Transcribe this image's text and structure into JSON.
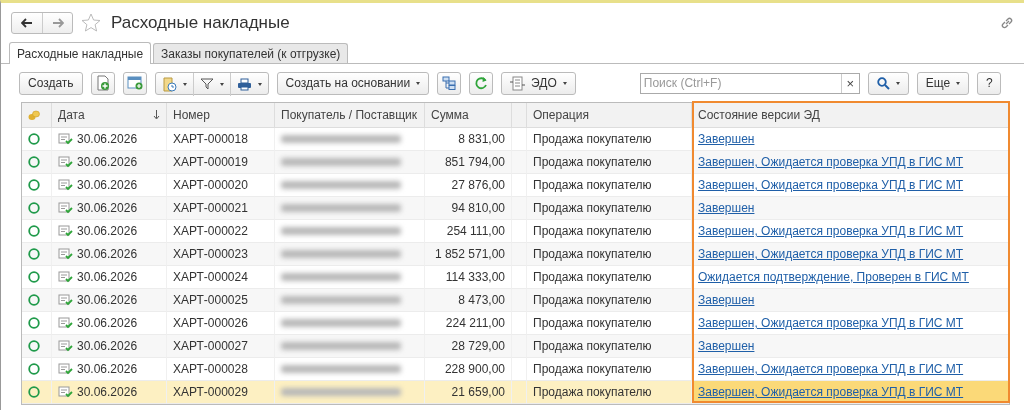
{
  "window": {
    "title": "Расходные накладные"
  },
  "tabs": [
    {
      "label": "Расходные накладные",
      "selected": true
    },
    {
      "label": "Заказы покупателей (к отгрузке)",
      "selected": false
    }
  ],
  "toolbar": {
    "create": "Создать",
    "create_based_on": "Создать на основании",
    "edo": "ЭДО",
    "search": {
      "placeholder": "Поиск (Ctrl+F)",
      "clear": "×"
    },
    "more": "Еще",
    "help": "?"
  },
  "table": {
    "columns": [
      "Дата",
      "Номер",
      "Покупатель / Поставщик",
      "Сумма",
      "Операция",
      "Состояние версии ЭД"
    ],
    "rows": [
      {
        "date": "30.06.2026",
        "number": "ХАРТ-000018",
        "sum": "8 831,00",
        "operation": "Продажа покупателю",
        "status": "Завершен",
        "selected": false
      },
      {
        "date": "30.06.2026",
        "number": "ХАРТ-000019",
        "sum": "851 794,00",
        "operation": "Продажа покупателю",
        "status": "Завершен, Ожидается проверка УПД в ГИС МТ",
        "selected": false
      },
      {
        "date": "30.06.2026",
        "number": "ХАРТ-000020",
        "sum": "27 876,00",
        "operation": "Продажа покупателю",
        "status": "Завершен, Ожидается проверка УПД в ГИС МТ",
        "selected": false
      },
      {
        "date": "30.06.2026",
        "number": "ХАРТ-000021",
        "sum": "94 810,00",
        "operation": "Продажа покупателю",
        "status": "Завершен",
        "selected": false
      },
      {
        "date": "30.06.2026",
        "number": "ХАРТ-000022",
        "sum": "254 111,00",
        "operation": "Продажа покупателю",
        "status": "Завершен, Ожидается проверка УПД в ГИС МТ",
        "selected": false
      },
      {
        "date": "30.06.2026",
        "number": "ХАРТ-000023",
        "sum": "1 852 571,00",
        "operation": "Продажа покупателю",
        "status": "Завершен, Ожидается проверка УПД в ГИС МТ",
        "selected": false
      },
      {
        "date": "30.06.2026",
        "number": "ХАРТ-000024",
        "sum": "114 333,00",
        "operation": "Продажа покупателю",
        "status": "Ожидается подтверждение, Проверен в ГИС МТ",
        "selected": false
      },
      {
        "date": "30.06.2026",
        "number": "ХАРТ-000025",
        "sum": "8 473,00",
        "operation": "Продажа покупателю",
        "status": "Завершен",
        "selected": false
      },
      {
        "date": "30.06.2026",
        "number": "ХАРТ-000026",
        "sum": "224 211,00",
        "operation": "Продажа покупателю",
        "status": "Завершен, Ожидается проверка УПД в ГИС МТ",
        "selected": false
      },
      {
        "date": "30.06.2026",
        "number": "ХАРТ-000027",
        "sum": "28 729,00",
        "operation": "Продажа покупателю",
        "status": "Завершен",
        "selected": false
      },
      {
        "date": "30.06.2026",
        "number": "ХАРТ-000028",
        "sum": "228 900,00",
        "operation": "Продажа покупателю",
        "status": "Завершен, Ожидается проверка УПД в ГИС МТ",
        "selected": false
      },
      {
        "date": "30.06.2026",
        "number": "ХАРТ-000029",
        "sum": "21 659,00",
        "operation": "Продажа покупателю",
        "status": "Завершен, Ожидается проверка УПД в ГИС МТ",
        "selected": true
      }
    ]
  }
}
